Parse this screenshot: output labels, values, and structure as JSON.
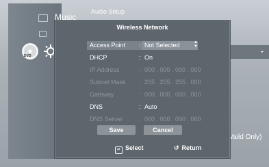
{
  "left_menu": {
    "music_label": "Music"
  },
  "header": {
    "title": "Audio Setup"
  },
  "side": {
    "note": "(Vaild Only)",
    "arrow": "▸"
  },
  "dialog": {
    "title": "Wireless Network",
    "rows": [
      {
        "label": "Access Point",
        "value": "Not Selected",
        "state": "selected"
      },
      {
        "label": "DHCP",
        "value": "On",
        "state": "active"
      },
      {
        "label": "IP Address",
        "value": "000 . 000 . 000 . 000",
        "state": "dim"
      },
      {
        "label": "Subnet Mask",
        "value": "255 . 255 . 255 . 000",
        "state": "dim"
      },
      {
        "label": "Gateway",
        "value": "000 . 000 . 000 . 000",
        "state": "dim"
      },
      {
        "label": "DNS",
        "value": "Auto",
        "state": "active"
      },
      {
        "label": "DNS Server",
        "value": "000 . 000 . 000 . 000",
        "state": "dim"
      }
    ],
    "colon": ":",
    "save_label": "Save",
    "cancel_label": "Cancel",
    "select_hint": "Select",
    "return_hint": "Return",
    "updown_icon": "up-down-arrow-icon",
    "select_icon": "enter-icon",
    "return_icon": "return-icon"
  }
}
